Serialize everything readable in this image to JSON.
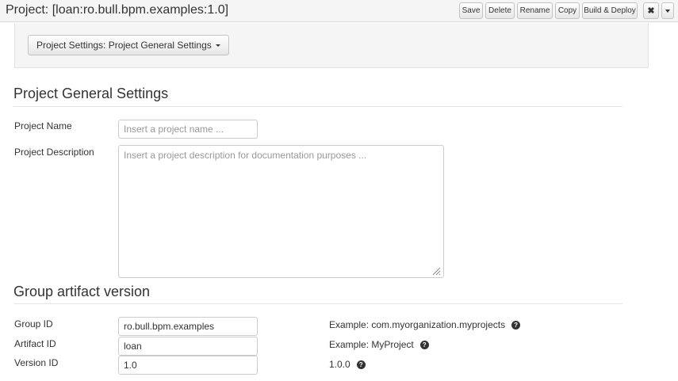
{
  "header": {
    "title": "Project: [loan:ro.bull.bpm.examples:1.0]",
    "buttons": {
      "save": "Save",
      "delete": "Delete",
      "rename": "Rename",
      "copy": "Copy",
      "build_deploy": "Build & Deploy"
    },
    "close_icon": "close-icon",
    "menu_icon": "caret-down-icon"
  },
  "settings_selector": {
    "label": "Project Settings: Project General Settings"
  },
  "general": {
    "heading": "Project General Settings",
    "name_label": "Project Name",
    "name_placeholder": "Insert a project name ...",
    "name_value": "",
    "description_label": "Project Description",
    "description_placeholder": "Insert a project description for documentation purposes ...",
    "description_value": ""
  },
  "gav": {
    "heading": "Group artifact version",
    "group_label": "Group ID",
    "group_value": "ro.bull.bpm.examples",
    "group_example": "Example: com.myorganization.myprojects",
    "artifact_label": "Artifact ID",
    "artifact_value": "loan",
    "artifact_example": "Example: MyProject",
    "version_label": "Version ID",
    "version_value": "1.0",
    "version_example": "1.0.0"
  },
  "colors": {
    "toolbar_bg": "#f5f5f5",
    "well_bg": "#f5f5f5",
    "text": "#333333",
    "placeholder": "#999999",
    "border": "#cccccc"
  }
}
